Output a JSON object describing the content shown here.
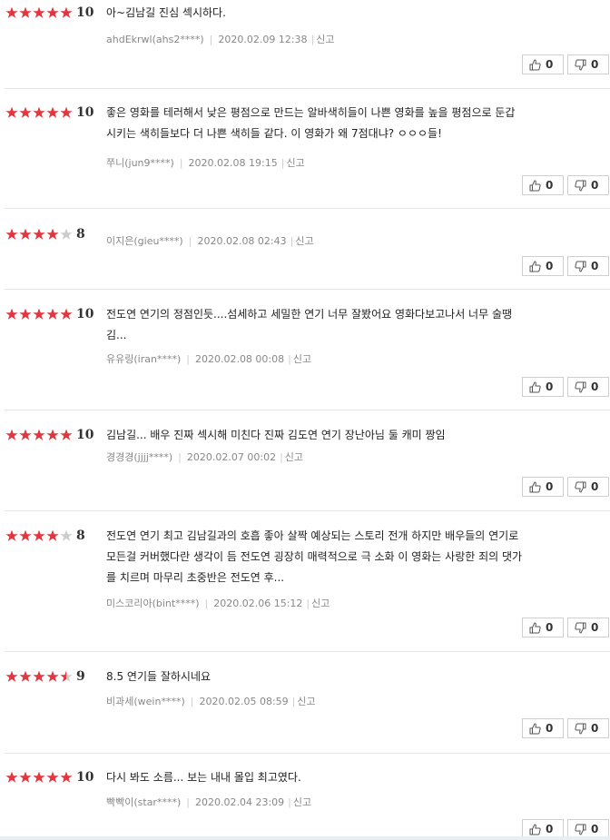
{
  "colors": {
    "star_filled": "#e2373f",
    "star_empty": "#cccccc"
  },
  "vote_icons": {
    "up": "thumbs-up-icon",
    "down": "thumbs-down-icon"
  },
  "reviews": [
    {
      "rating": 5,
      "score": "10",
      "lines": [
        "아~김남길 진심 섹시하다."
      ],
      "author": "ahdEkrwl(ahs2****)",
      "date": "2020.02.09 12:38",
      "report": "신고",
      "up": "0",
      "down": "0"
    },
    {
      "rating": 5,
      "score": "10",
      "lines": [
        "좋은 영화를 테러해서 낮은 평점으로 만드는 알바색히들이 나쁜 영화를 높을 평점으로 둔갑",
        "시키는 색히들보다 더 나쁜 색히들 같다. 이 영화가 왜 7점대냐? ㅇㅇㅇ들!"
      ],
      "author": "쭈니(jun9****)",
      "date": "2020.02.08 19:15",
      "report": "신고",
      "up": "0",
      "down": "0"
    },
    {
      "rating": 4,
      "score": "8",
      "lines": [],
      "author": "이지은(gieu****)",
      "date": "2020.02.08 02:43",
      "report": "신고",
      "up": "0",
      "down": "0"
    },
    {
      "rating": 5,
      "score": "10",
      "lines": [
        "전도연 연기의 정점인듯....섬세하고 세밀한 연기 너무 잘봤어요 영화다보고나서 너무 술땡",
        "김..."
      ],
      "author": "유유링(iran****)",
      "date": "2020.02.08 00:08",
      "report": "신고",
      "up": "0",
      "down": "0"
    },
    {
      "rating": 5,
      "score": "10",
      "lines": [
        "김남길... 배우 진짜 섹시해 미친다 진짜 김도연 연기 장난아님 둘 캐미 짱임"
      ],
      "author": "경경경(jjjj****)",
      "date": "2020.02.07 00:02",
      "report": "신고",
      "up": "0",
      "down": "0"
    },
    {
      "rating": 4,
      "score": "8",
      "lines": [
        "전도연 연기 최고 김남길과의 호흡 좋아 살짝 예상되는 스토리 전개 하지만 배우들의 연기로",
        "모든걸 커버했다란 생각이 듬 전도연 굉장히 매력적으로 극 소화 이 영화는 사랑한 죄의 댓가",
        "를 치르며 마무리 초중반은 전도연 후..."
      ],
      "author": "미스코리아(bint****)",
      "date": "2020.02.06 15:12",
      "report": "신고",
      "up": "0",
      "down": "0"
    },
    {
      "rating": 4.5,
      "score": "9",
      "lines": [
        "8.5 연기들 잘하시네요"
      ],
      "author": "비과세(wein****)",
      "date": "2020.02.05 08:59",
      "report": "신고",
      "up": "0",
      "down": "0"
    },
    {
      "rating": 5,
      "score": "10",
      "lines": [
        "다시 봐도 소름... 보는 내내 몰입 최고였다."
      ],
      "author": "빡빡이(star****)",
      "date": "2020.02.04 23:09",
      "report": "신고",
      "up": "0",
      "down": "0"
    }
  ]
}
